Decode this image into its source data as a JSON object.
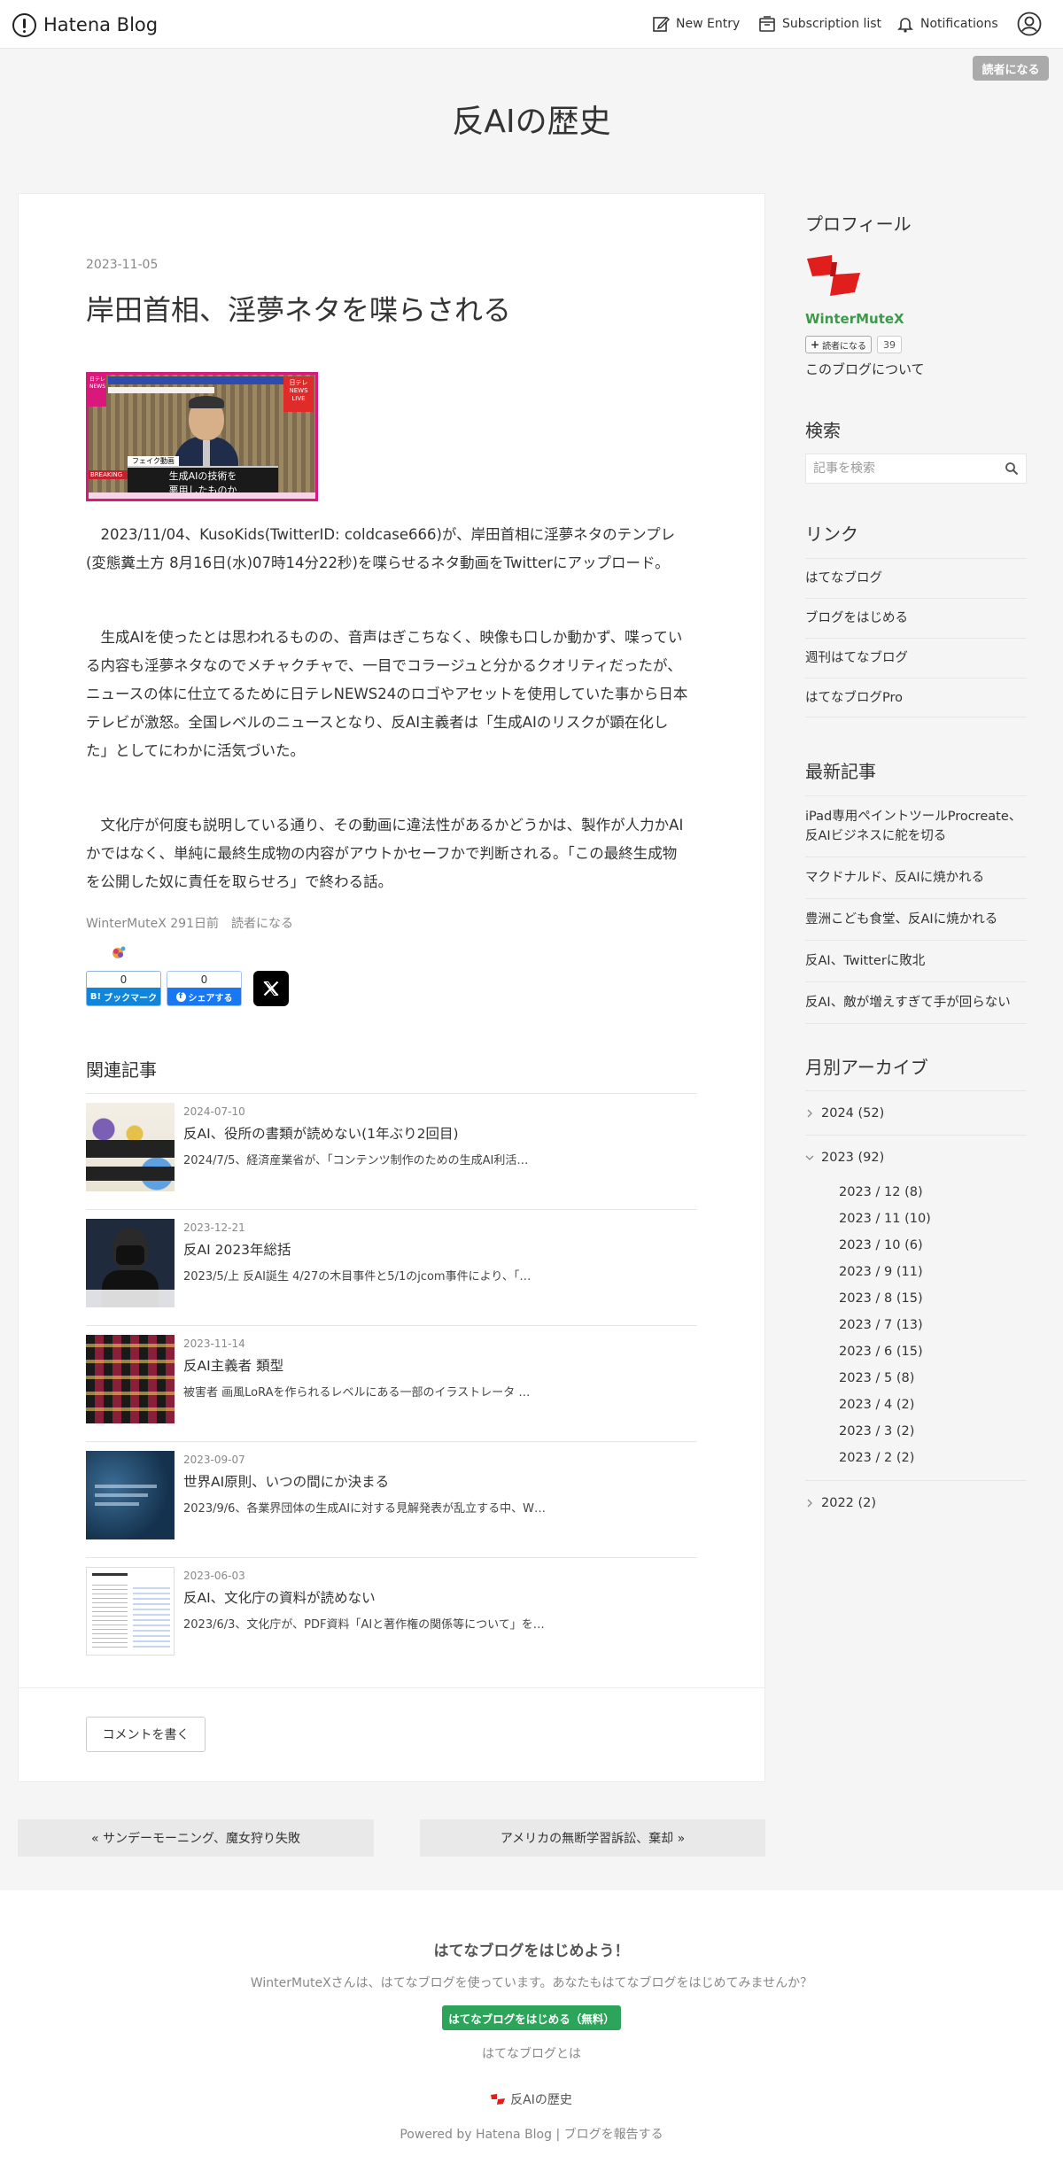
{
  "header": {
    "logo_text": "Hatena Blog",
    "new_entry": "New Entry",
    "subscription": "Subscription list",
    "notifications": "Notifications",
    "follow": "読者になる"
  },
  "blog": {
    "title": "反AIの歴史"
  },
  "article": {
    "date": "2023-11-05",
    "title": "岸田首相、淫夢ネタを喋らされる",
    "image": {
      "caption_line1": "生成AIの技術を",
      "caption_line2": "悪用したものか",
      "fake_label": "フェイク動画",
      "corner_left": "日テレNEWS",
      "corner_right": "日テレNEWS LIVE",
      "break": "BREAKING"
    },
    "paragraphs": [
      "　2023/11/04、KusoKids(TwitterID: coldcase666)が、岸田首相に淫夢ネタのテンプレ(変態糞土方 8月16日(水)07時14分22秒)を喋らせるネタ動画をTwitterにアップロード。",
      "　生成AIを使ったとは思われるものの、音声はぎこちなく、映像も口しか動かず、喋っている内容も淫夢ネタなのでメチャクチャで、一目でコラージュと分かるクオリティだったが、ニュースの体に仕立てるために日テレNEWS24のロゴやアセットを使用していた事から日本テレビが激怒。全国レベルのニュースとなり、反AI主義者は「生成AIのリスクが顕在化した」としてにわかに活気づいた。",
      "　文化庁が何度も説明している通り、その動画に違法性があるかどうかは、製作が人力かAIかではなく、単純に最終生成物の内容がアウトかセーフかで判断される。「この最終生成物を公開した奴に責任を取らせろ」で終わる話。"
    ],
    "author": "WinterMuteX",
    "ago": "291日前",
    "follow": "読者になる",
    "bookmark_count": "0",
    "bookmark_label": "ブックマーク",
    "share_count": "0",
    "share_label": "シェアする",
    "x_label": "X"
  },
  "related": {
    "heading": "関連記事",
    "items": [
      {
        "date": "2024-07-10",
        "title": "反AI、役所の書類が読めない(1年ぶり2回目)",
        "desc": "2024/7/5、経済産業省が、「コンテンツ制作のための生成AI利活…"
      },
      {
        "date": "2023-12-21",
        "title": "反AI 2023年総括",
        "desc": "2023/5/上 反AI誕生 4/27の木目事件と5/1のjcom事件により、「…"
      },
      {
        "date": "2023-11-14",
        "title": "反AI主義者 類型",
        "desc": "被害者 画風LoRAを作られるレベルにある一部のイラストレータ …"
      },
      {
        "date": "2023-09-07",
        "title": "世界AI原則、いつの間にか決まる",
        "desc": "2023/9/6、各業界団体の生成AIに対する見解発表が乱立する中、W…"
      },
      {
        "date": "2023-06-03",
        "title": "反AI、文化庁の資料が読めない",
        "desc": "2023/6/3、文化庁が、PDF資料「AIと著作権の関係等について」を…"
      }
    ]
  },
  "comment": {
    "button": "コメントを書く"
  },
  "sidebar": {
    "profile": {
      "heading": "プロフィール",
      "name": "WinterMuteX",
      "follow": "読者になる",
      "count": "39",
      "about": "このブログについて"
    },
    "search": {
      "heading": "検索",
      "placeholder": "記事を検索"
    },
    "links": {
      "heading": "リンク",
      "items": [
        "はてなブログ",
        "ブログをはじめる",
        "週刊はてなブログ",
        "はてなブログPro"
      ]
    },
    "recent": {
      "heading": "最新記事",
      "items": [
        "iPad専用ペイントツールProcreate、反AIビジネスに舵を切る",
        "マクドナルド、反AIに焼かれる",
        "豊洲こども食堂、反AIに焼かれる",
        "反AI、Twitterに敗北",
        "反AI、敵が増えすぎて手が回らない"
      ]
    },
    "archive": {
      "heading": "月別アーカイブ",
      "y2024": "2024 (52)",
      "y2023": "2023 (92)",
      "months": [
        "2023 / 12 (8)",
        "2023 / 11 (10)",
        "2023 / 10 (6)",
        "2023 / 9 (11)",
        "2023 / 8 (15)",
        "2023 / 7 (13)",
        "2023 / 6 (15)",
        "2023 / 5 (8)",
        "2023 / 4 (2)",
        "2023 / 3 (2)",
        "2023 / 2 (2)"
      ],
      "y2022": "2022 (2)"
    }
  },
  "pager": {
    "prev": "« サンデーモーニング、魔女狩り失敗",
    "next": "アメリカの無断学習訴訟、棄却 »"
  },
  "footer": {
    "heading": "はてなブログをはじめよう！",
    "message": "WinterMuteXさんは、はてなブログを使っています。あなたもはてなブログをはじめてみませんか？",
    "button": "はてなブログをはじめる（無料）",
    "about": "はてなブログとは",
    "blog_name": "反AIの歴史",
    "powered": "Powered by Hatena Blog",
    "report": "ブログを報告する"
  },
  "colors": {
    "accent_green": "#2ca55a",
    "profile_red": "#e01e1e",
    "bookmark_blue": "#1185d9",
    "facebook_blue": "#1877f2"
  }
}
